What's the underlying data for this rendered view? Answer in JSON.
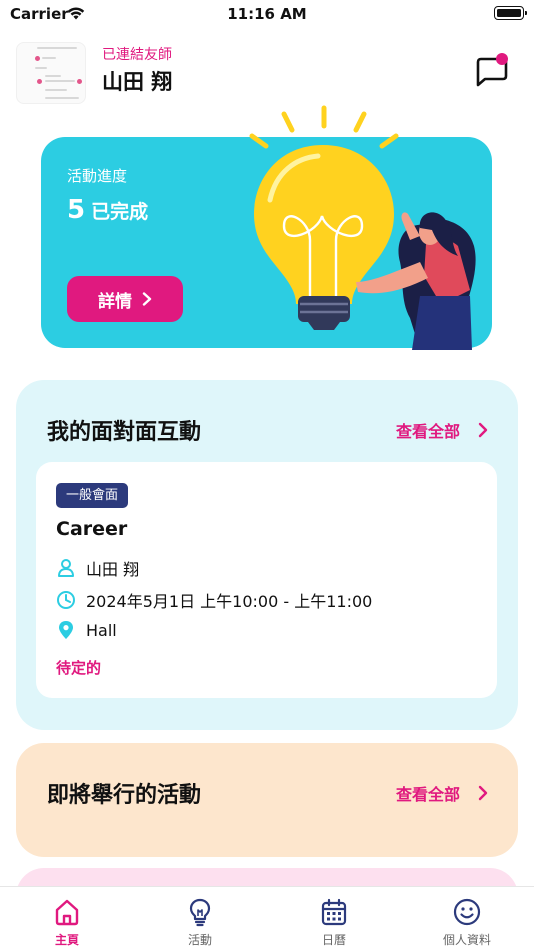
{
  "status_bar": {
    "carrier": "Carrier",
    "time": "11:16 AM"
  },
  "header": {
    "connected_label": "已連結友師",
    "user_name": "山田 翔"
  },
  "progress_card": {
    "title": "活動進度",
    "count": "5",
    "count_suffix": "已完成",
    "button_label": "詳情"
  },
  "meetings": {
    "title": "我的面對面互動",
    "view_all": "查看全部",
    "item": {
      "badge": "一般會面",
      "topic": "Career",
      "person": "山田 翔",
      "datetime": "2024年5月1日 上午10:00 - 上午11:00",
      "location": "Hall",
      "status": "待定的"
    }
  },
  "upcoming": {
    "title": "即將舉行的活動",
    "view_all": "查看全部"
  },
  "tabs": [
    {
      "label": "主頁",
      "icon": "home-icon",
      "active": true
    },
    {
      "label": "活動",
      "icon": "lightbulb-icon",
      "active": false
    },
    {
      "label": "日曆",
      "icon": "calendar-icon",
      "active": false
    },
    {
      "label": "個人資料",
      "icon": "smiley-icon",
      "active": false
    }
  ],
  "colors": {
    "accent": "#e0197f",
    "hero": "#2ccde2",
    "navy": "#2c3a7c",
    "card_blue": "#dff6fa",
    "card_orange": "#fde6cd",
    "card_pink": "#fde0ef"
  }
}
